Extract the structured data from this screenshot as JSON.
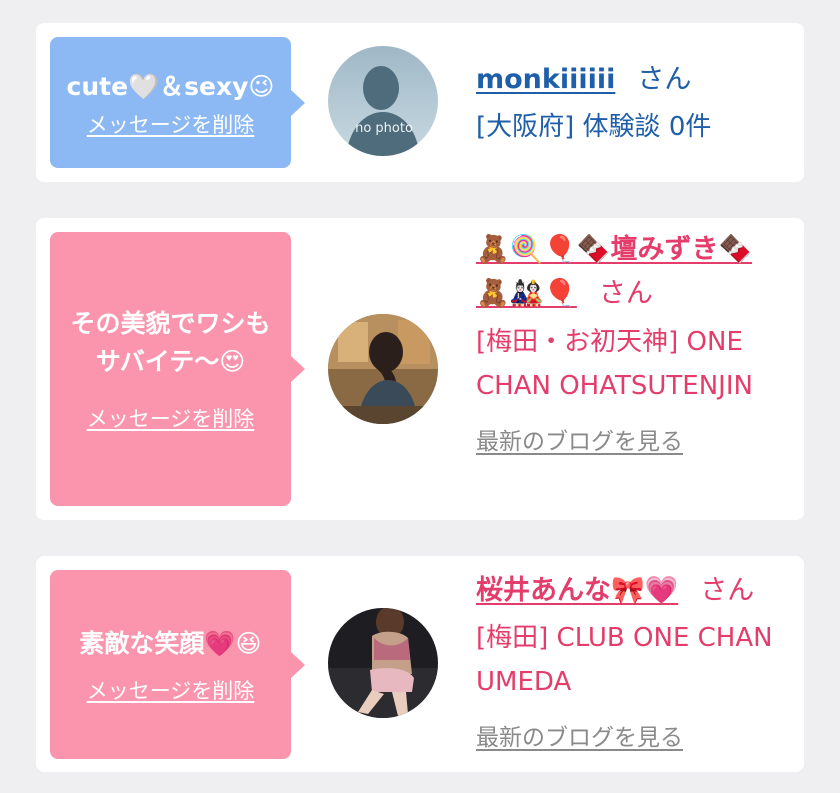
{
  "cards": [
    {
      "message": "cute🤍＆sexy😉",
      "delete_label": "メッセージを削除",
      "avatar": "no photo",
      "username": "monkiiiiii",
      "honorific": "さん",
      "detail": "[大阪府] 体験談 0件",
      "bubble_color": "#8cb8f3",
      "text_color": "#1f5ea8"
    },
    {
      "message": "その美貌でワシもサバイテ〜😍",
      "delete_label": "メッセージを削除",
      "username": "🧸🍭🎈🍫壇みずき🍫🧸🎎🎈",
      "honorific": "さん",
      "detail": "[梅田・お初天神] ONE CHAN OHATSUTENJIN",
      "blog_label": "最新のブログを見る",
      "bubble_color": "#fb95ad",
      "text_color": "#e43d6b"
    },
    {
      "message": "素敵な笑顔💗😆",
      "delete_label": "メッセージを削除",
      "username": "桜井あんな🎀💗",
      "honorific": "さん",
      "detail": "[梅田] CLUB ONE CHAN UMEDA",
      "blog_label": "最新のブログを見る",
      "bubble_color": "#fb95ad",
      "text_color": "#e43d6b"
    }
  ]
}
